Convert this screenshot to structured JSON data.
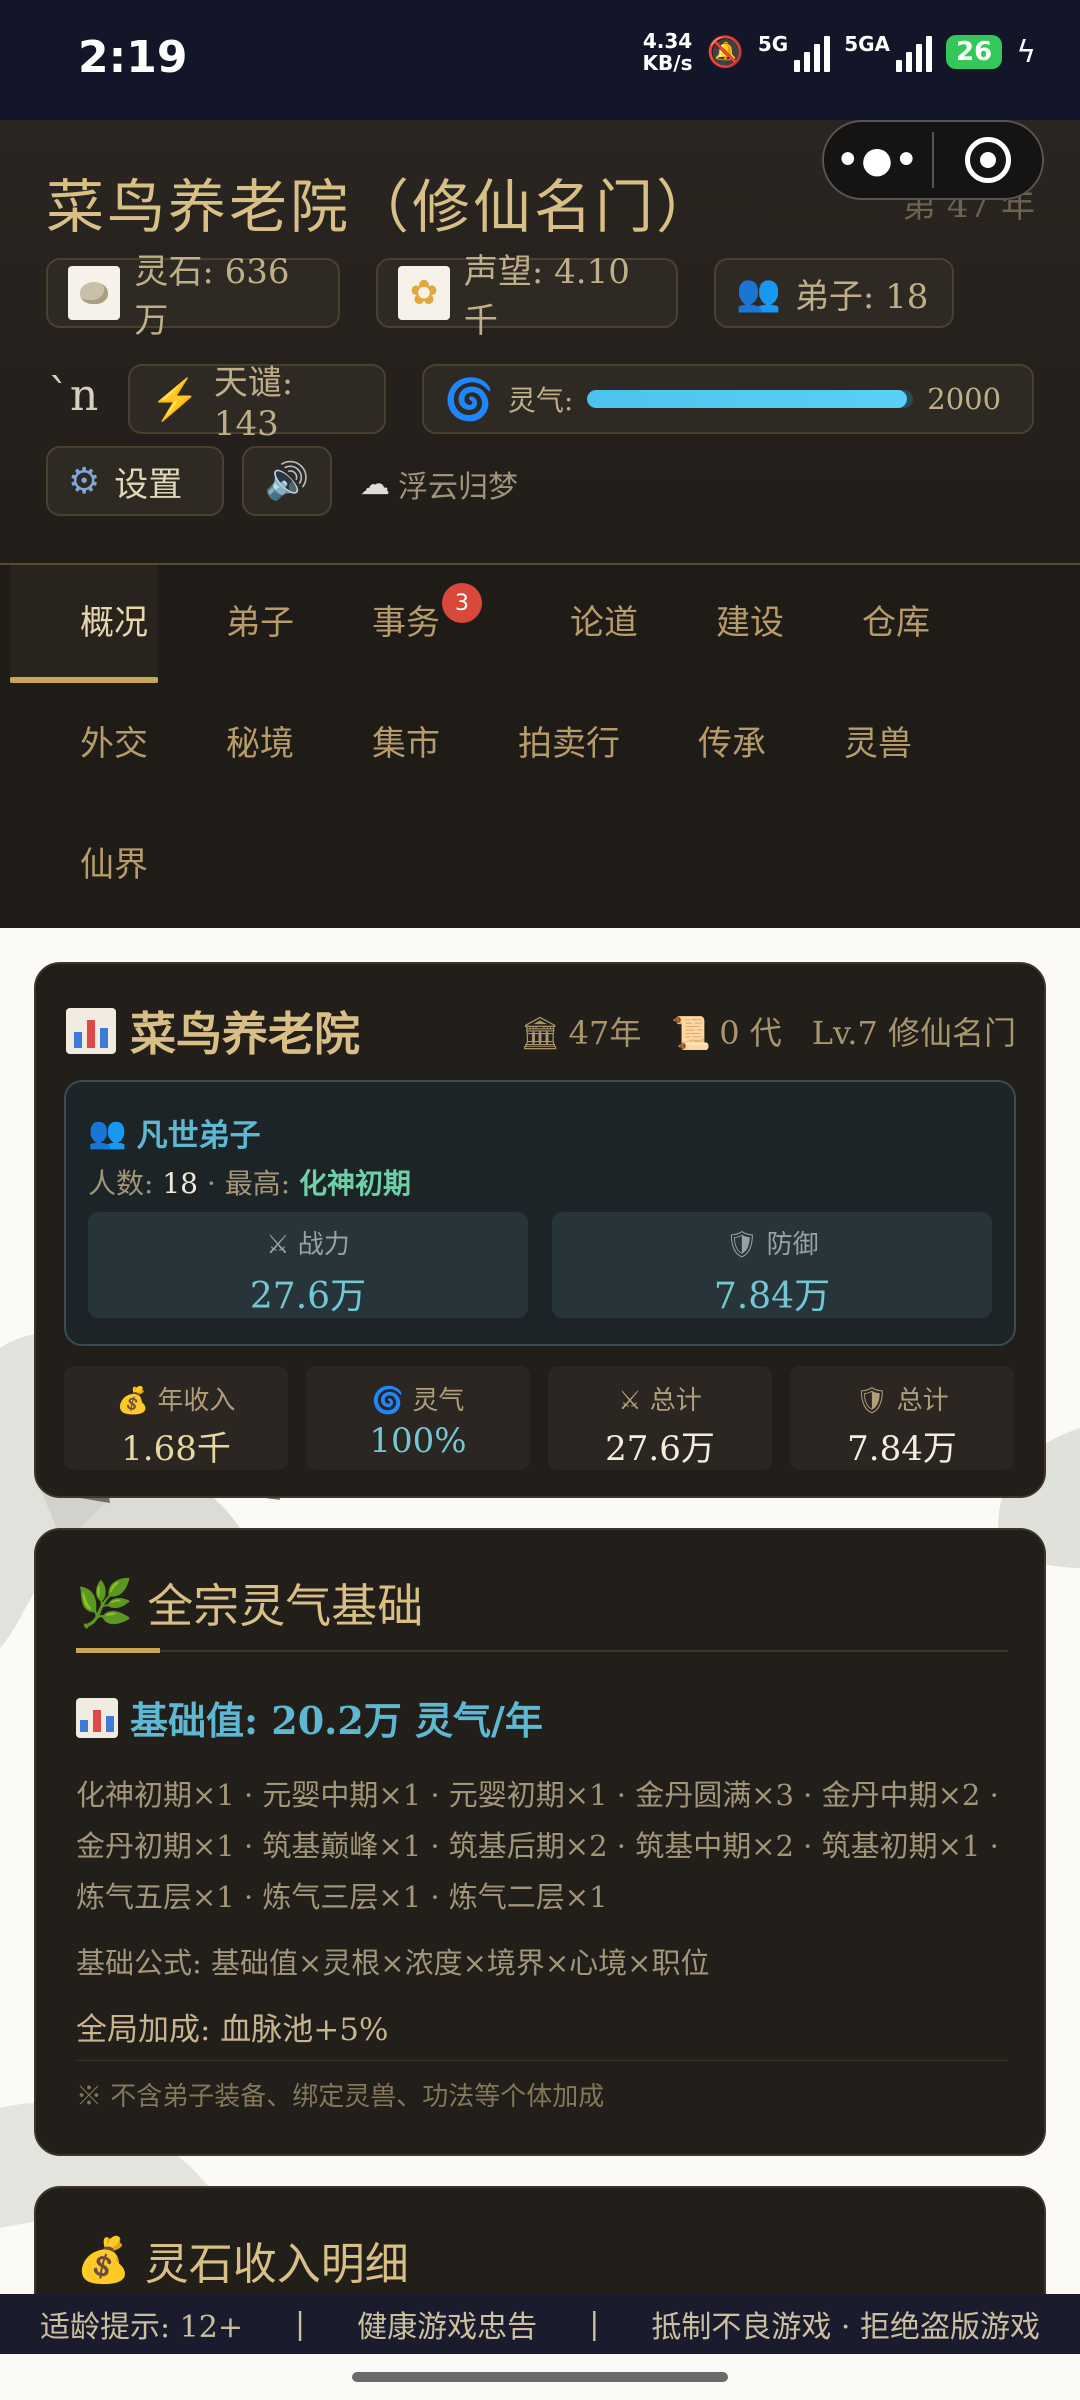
{
  "status_bar": {
    "time": "2:19",
    "net_speed_value": "4.34",
    "net_speed_unit": "KB/s",
    "sim1_label": "5G",
    "sim2_label": "5GA",
    "battery": "26"
  },
  "header": {
    "title": "菜鸟养老院（修仙名门）",
    "year": "第 47 年",
    "resources": {
      "spirit_stone": "灵石: 636万",
      "reputation": "声望: 4.10千",
      "disciples": "弟子: 18",
      "stray_text": "`n",
      "tribulation": "天谴: 143",
      "qi_label": "灵气:",
      "qi_value": "2000",
      "qi_fill": 0.98
    },
    "settings_label": "设置",
    "cloud_text": "浮云归梦"
  },
  "nav": {
    "tabs": [
      {
        "label": "概况"
      },
      {
        "label": "弟子"
      },
      {
        "label": "事务",
        "badge": "3"
      },
      {
        "label": "论道"
      },
      {
        "label": "建设"
      },
      {
        "label": "仓库"
      },
      {
        "label": "外交"
      },
      {
        "label": "秘境"
      },
      {
        "label": "集市"
      },
      {
        "label": "拍卖行"
      },
      {
        "label": "传承"
      },
      {
        "label": "灵兽"
      },
      {
        "label": "仙界"
      }
    ]
  },
  "overview": {
    "name": "菜鸟养老院",
    "years": "47年",
    "generation": "0 代",
    "level": "Lv.7 修仙名门",
    "group": {
      "title": "凡世弟子",
      "count_label": "人数:",
      "count": "18",
      "highest_label": "· 最高:",
      "highest": "化神初期",
      "attack_label": "战力",
      "attack": "27.6万",
      "defense_label": "防御",
      "defense": "7.84万"
    },
    "stats": [
      {
        "label": "年收入",
        "value": "1.68千",
        "color": "#e8d7a0"
      },
      {
        "label": "灵气",
        "value": "100%",
        "color": "#73c7d3"
      },
      {
        "label": "总计",
        "value": "27.6万",
        "color": "#f3eddd"
      },
      {
        "label": "总计",
        "value": "7.84万",
        "color": "#f3eddd"
      }
    ]
  },
  "qi_base": {
    "title": "全宗灵气基础",
    "base_value": "基础值: 20.2万 灵气/年",
    "list": "化神初期×1 · 元婴中期×1 · 元婴初期×1 · 金丹圆满×3 · 金丹中期×2 · 金丹初期×1 · 筑基巅峰×1 · 筑基后期×2 · 筑基中期×2 · 筑基初期×1 · 炼气五层×1 · 炼气三层×1 · 炼气二层×1",
    "formula": "基础公式: 基础值×灵根×浓度×境界×心境×职位",
    "global_bonus": "全局加成: 血脉池+5%",
    "note": "※ 不含弟子装备、绑定灵兽、功法等个体加成"
  },
  "income": {
    "title": "灵石收入明细"
  },
  "footer": {
    "age_hint": "适龄提示: 12+",
    "sep1": "|",
    "health": "健康游戏忠告",
    "sep2": "|",
    "anti": "抵制不良游戏 · 拒绝盗版游戏"
  }
}
